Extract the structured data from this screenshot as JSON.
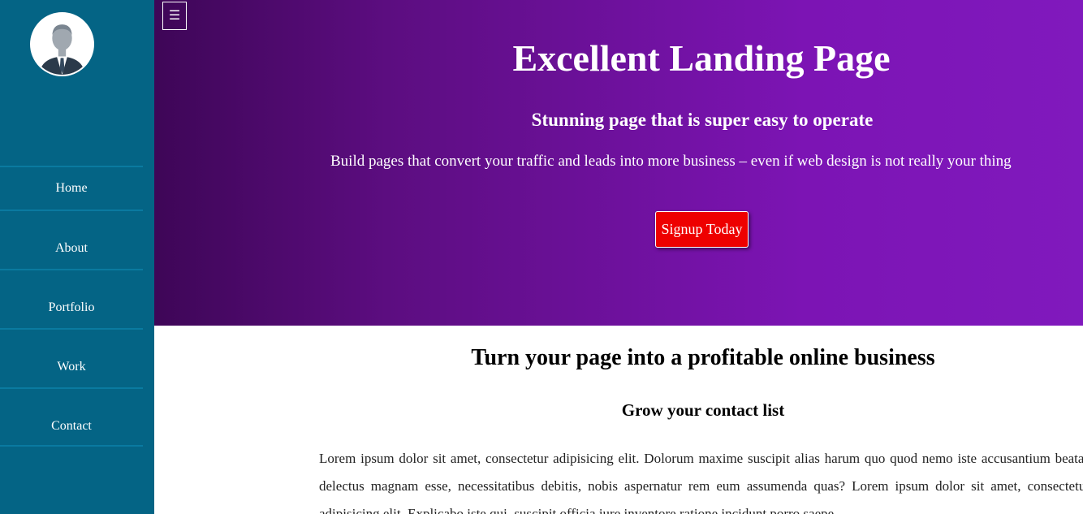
{
  "sidebar": {
    "avatar_alt": "user avatar",
    "items": [
      {
        "label": "Home"
      },
      {
        "label": "About"
      },
      {
        "label": "Portfolio"
      },
      {
        "label": "Work"
      },
      {
        "label": "Contact"
      }
    ]
  },
  "hero": {
    "menu_icon": "☰",
    "title": "Excellent Landing Page",
    "subtitle": "Stunning page that is super easy to operate",
    "text": "Build pages that convert your traffic and leads into more business – even if web design is not really your thing",
    "button_label": "Signup Today"
  },
  "content": {
    "title": "Turn your page into a profitable online business",
    "subtitle": "Grow your contact list",
    "paragraph": "Lorem ipsum dolor sit amet, consectetur adipisicing elit. Dolorum maxime suscipit alias harum quo quod nemo iste accusantium beatae delectus magnam esse, necessitatibus debitis, nobis aspernatur rem eum assumenda quas? Lorem ipsum dolor sit amet, consectetur adipisicing elit. Explicabo iste qui, suscipit officia iure inventore ratione incidunt porro saepe"
  },
  "colors": {
    "sidebar_bg": "#046485",
    "hero_gradient_start": "#3e0657",
    "hero_gradient_end": "#8019bd",
    "signup_button": "#ee0000"
  }
}
